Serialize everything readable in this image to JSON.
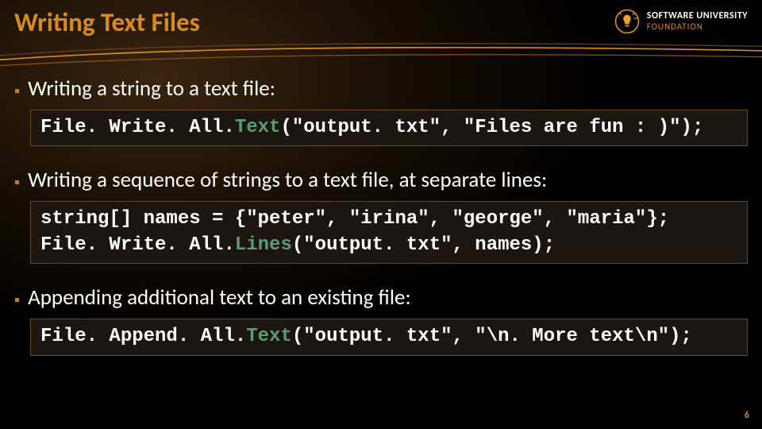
{
  "title": "Writing Text Files",
  "logo": {
    "line1": "SOFTWARE UNIVERSITY",
    "line2": "FOUNDATION"
  },
  "bullets": [
    {
      "text": "Writing a string to a text file:",
      "code_html": "<span class='c-white'>File. Write. All.</span><span class='c-green'>Text</span><span class='c-white'>(\"output. txt\", \"Files are fun : )\");</span>"
    },
    {
      "text": "Writing a sequence of strings to a text file, at separate lines:",
      "code_html": "<span class='c-white'>string[] names = {\"peter\", \"irina\", \"george\", \"maria\"};</span>\n<span class='c-white'>File. Write. All.</span><span class='c-green'>Lines</span><span class='c-white'>(\"output. txt\", names);</span>"
    },
    {
      "text": "Appending additional text to an existing file:",
      "code_html": "<span class='c-white'>File. Append. All.</span><span class='c-green'>Text</span><span class='c-white'>(\"output. txt\", \"\\n. More text\\n\");</span>"
    }
  ],
  "page_number": "6"
}
